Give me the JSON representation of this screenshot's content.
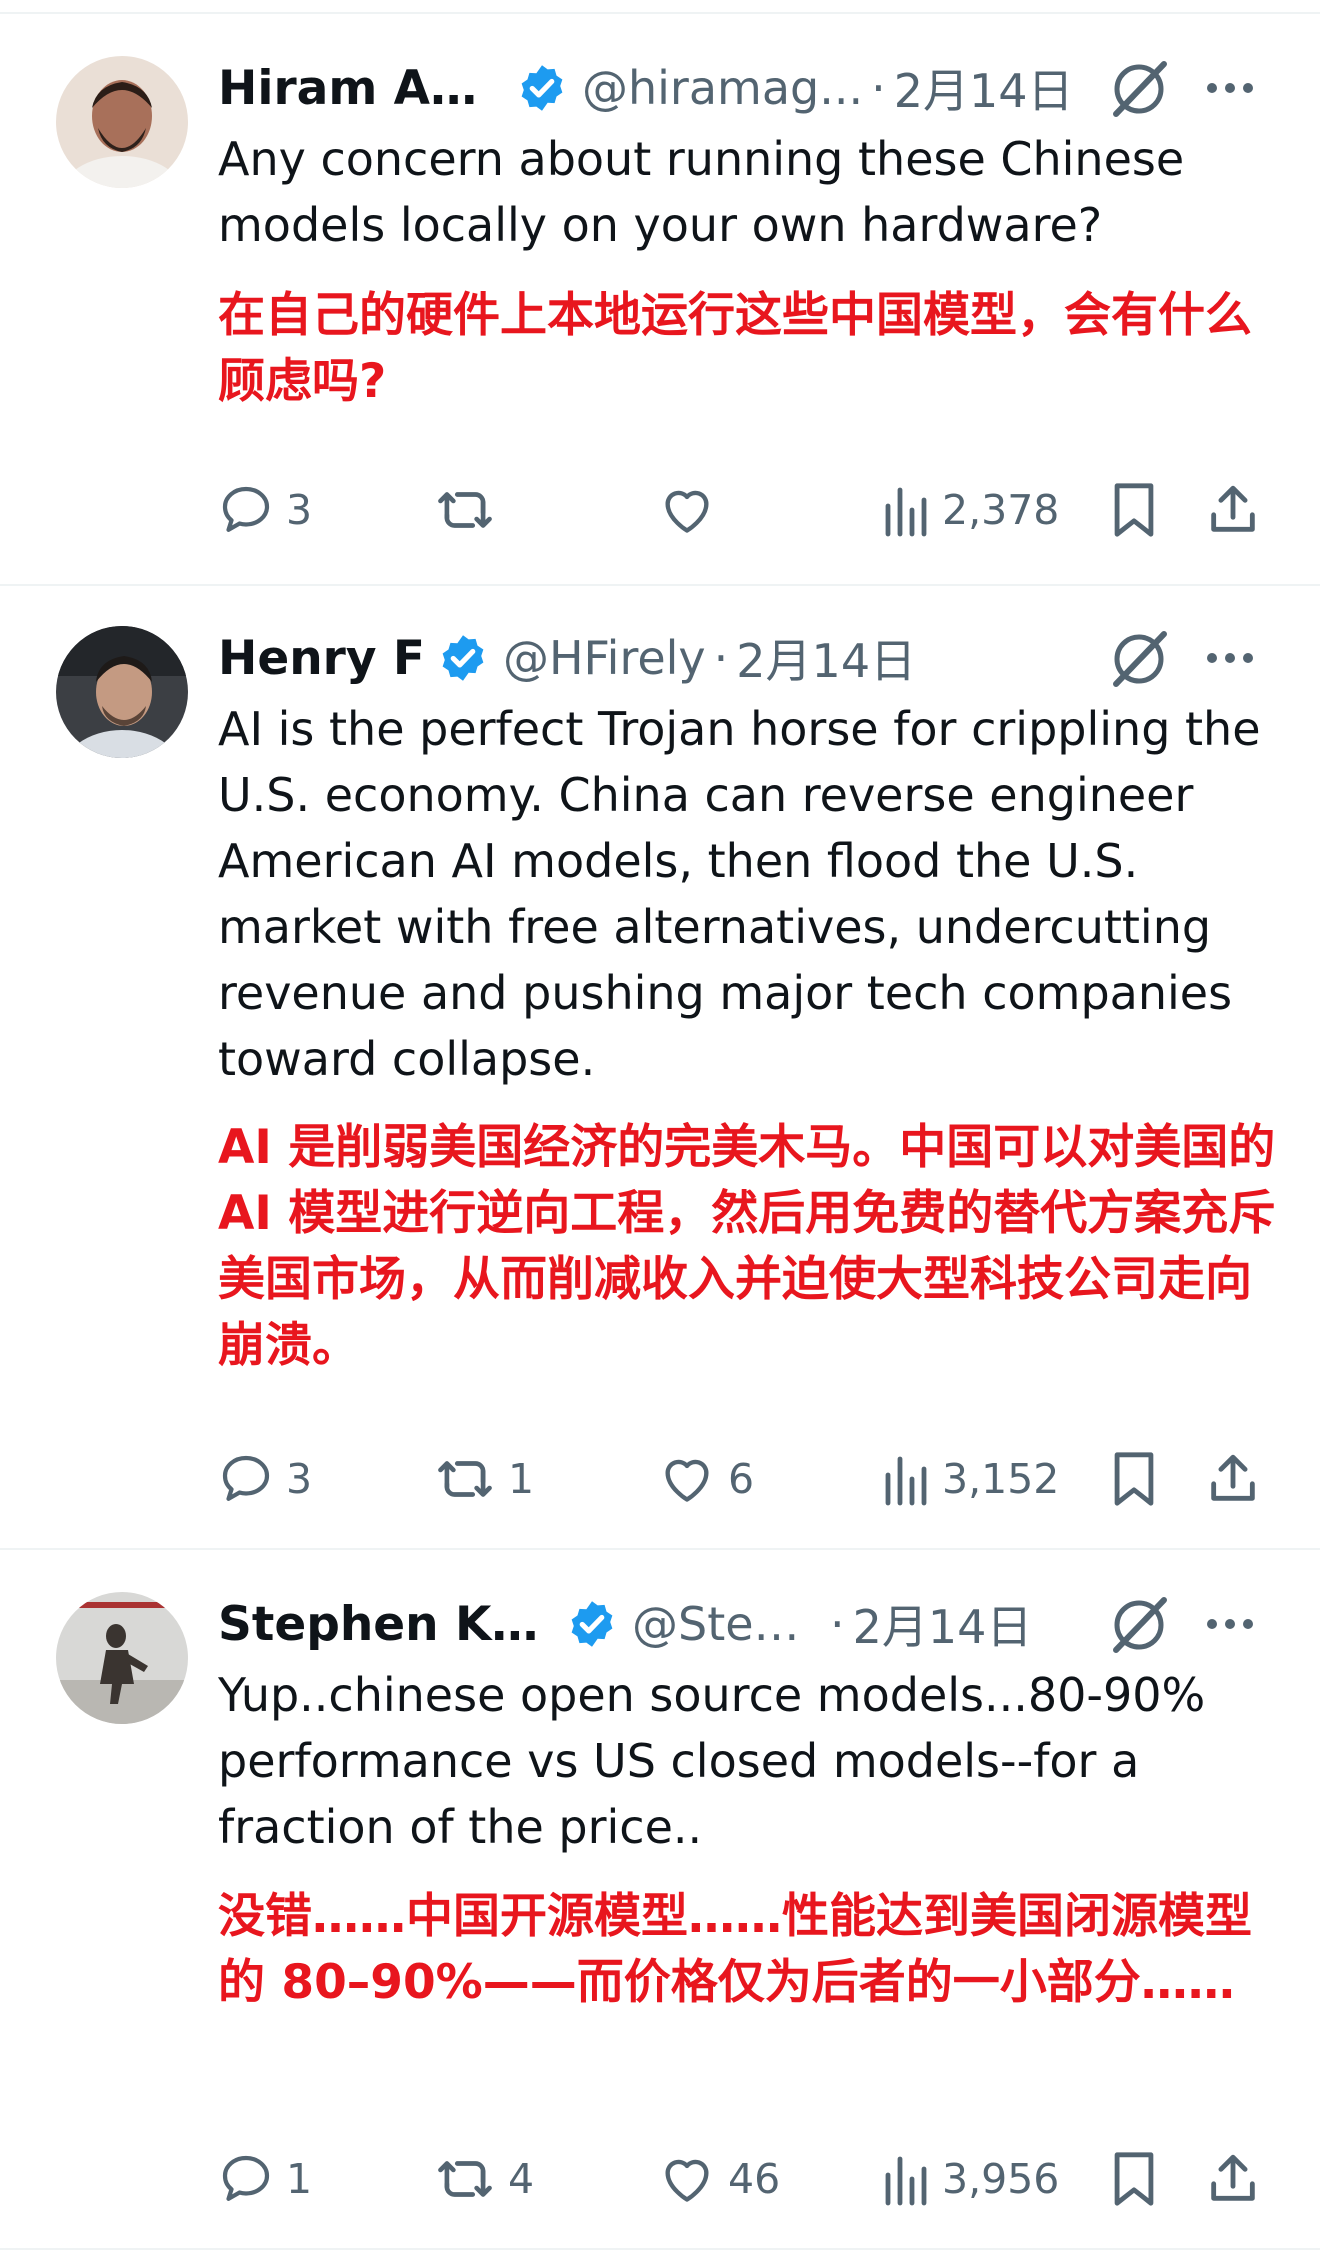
{
  "tweets": [
    {
      "name": "Hiram Ag...",
      "handle": "@hiramag...",
      "date": "2月14日",
      "text_en": "Any concern about running these Chinese models locally on your own hardware?",
      "text_zh": "在自己的硬件上本地运行这些中国模型，会有什么顾虑吗?",
      "replies": "3",
      "reposts": "",
      "likes": "",
      "views": "2,378"
    },
    {
      "name": "Henry F",
      "handle": "@HFirely",
      "date": "2月14日",
      "text_en": "AI is the perfect Trojan horse for crippling the U.S. economy. China can reverse engineer American AI models, then flood the U.S. market with free alternatives, undercutting revenue and pushing major tech companies toward collapse.",
      "text_zh": "AI 是削弱美国经济的完美木马。中国可以对美国的 AI 模型进行逆向工程，然后用免费的替代方案充斥美国市场，从而削减收入并迫使大型科技公司走向崩溃。",
      "replies": "3",
      "reposts": "1",
      "likes": "6",
      "views": "3,152"
    },
    {
      "name": "Stephen Kal...",
      "handle": "@Step...",
      "date": "2月14日",
      "text_en": "Yup..chinese open source models...80-90% performance vs US closed models--for a fraction of the price..",
      "text_zh": "没错……中国开源模型……性能达到美国闭源模型的 80–90%——而价格仅为后者的一小部分……",
      "replies": "1",
      "reposts": "4",
      "likes": "46",
      "views": "3,956"
    }
  ],
  "icons": {
    "verified": "verified-badge-icon",
    "grok": "grok-icon",
    "more": "more-icon",
    "reply": "reply-icon",
    "repost": "repost-icon",
    "like": "like-icon",
    "views": "views-icon",
    "bookmark": "bookmark-icon",
    "share": "share-icon"
  },
  "colors": {
    "verified": "#1d9bf0",
    "translation": "#e8161e",
    "secondary": "#536471"
  }
}
